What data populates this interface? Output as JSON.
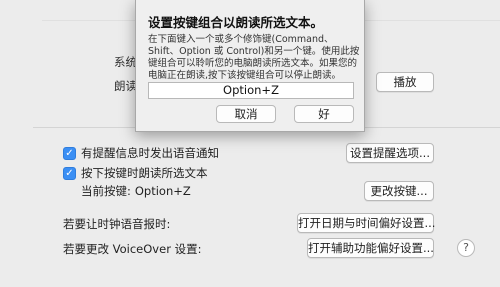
{
  "background": {
    "partial_label_1": "系统",
    "partial_label_2": "朗读",
    "play_button": "播放"
  },
  "settings": {
    "notify_checkbox_label": "有提醒信息时发出语音通知",
    "notify_checked": true,
    "notify_button": "设置提醒选项...",
    "speak_selected_label": "按下按键时朗读所选文本",
    "speak_selected_checked": true,
    "current_key_label": "当前按键:",
    "current_key_value": "Option+Z",
    "change_key_button": "更改按键...",
    "clock_label": "若要让时钟语音报时:",
    "clock_button": "打开日期与时间偏好设置...",
    "voiceover_label": "若要更改 VoiceOver 设置:",
    "voiceover_button": "打开辅助功能偏好设置...",
    "help_icon": "question-mark-icon",
    "help_glyph": "?"
  },
  "sheet": {
    "title": "设置按键组合以朗读所选文本。",
    "description": "在下面键入一个或多个修饰键(Command、Shift、Option 或 Control)和另一个键。使用此按键组合可以聆听您的电脑朗读所选文本。如果您的电脑正在朗读,按下该按键组合可以停止朗读。",
    "shortcut_field_value": "Option+Z",
    "cancel_button": "取消",
    "ok_button": "好"
  },
  "checkmark_glyph": "✓",
  "colors": {
    "accent_checkbox": "#3b8ff4",
    "window_background": "#ececec"
  }
}
